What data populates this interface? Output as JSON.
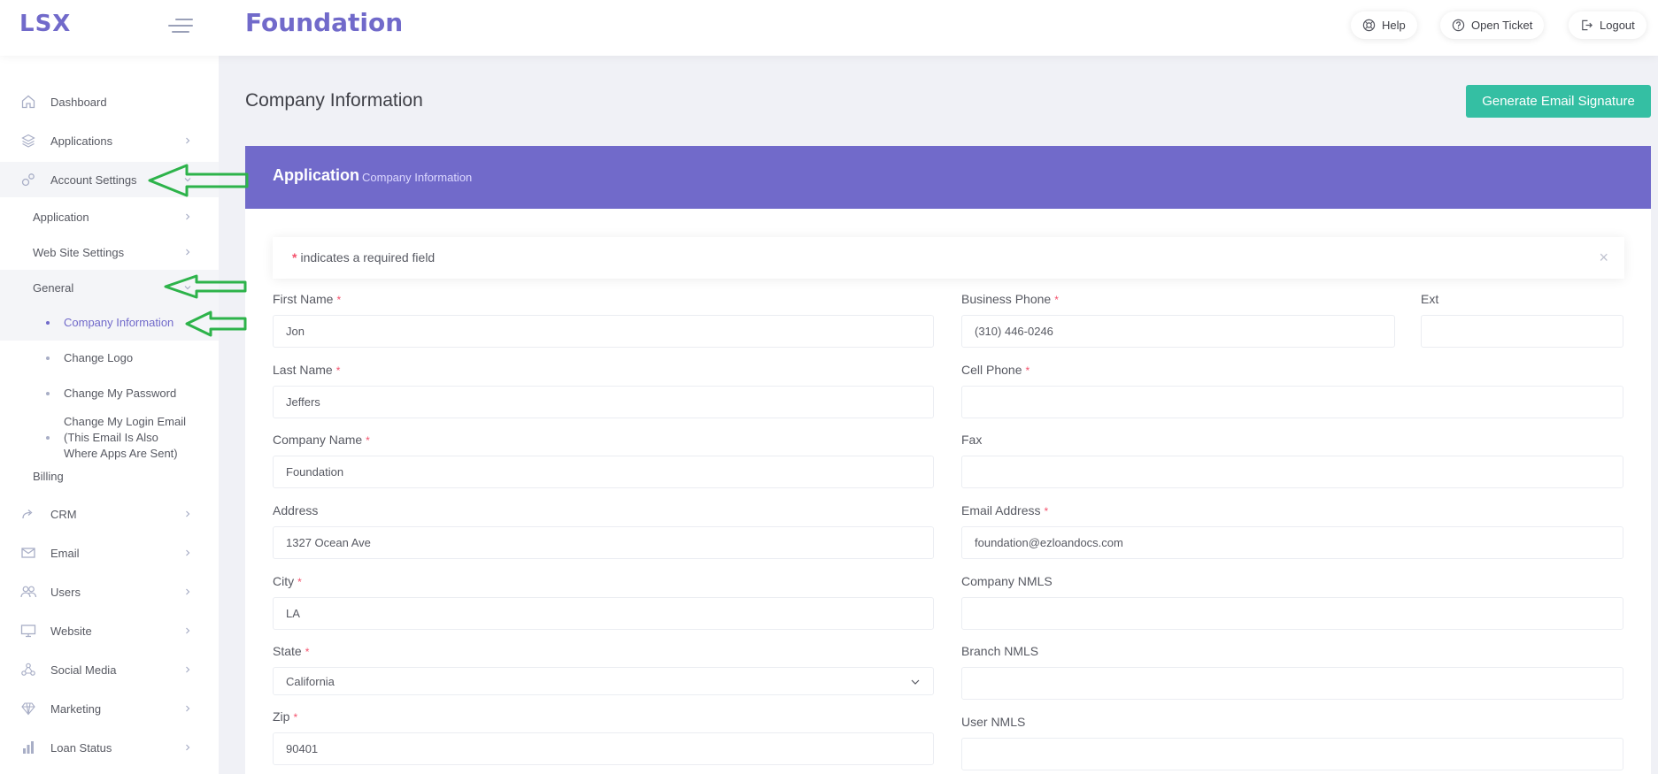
{
  "header": {
    "logo": "LSX",
    "title": "Foundation",
    "buttons": {
      "help": "Help",
      "open_ticket": "Open Ticket",
      "logout": "Logout"
    }
  },
  "sidebar": {
    "items": {
      "dashboard": "Dashboard",
      "applications": "Applications",
      "account_settings": "Account Settings",
      "application": "Application",
      "web_site_settings": "Web Site Settings",
      "general": "General",
      "company_information": "Company Information",
      "change_logo": "Change Logo",
      "change_password": "Change My Password",
      "change_login_email_1": "Change My Login Email",
      "change_login_email_2": "(This Email Is Also",
      "change_login_email_3": "Where Apps Are Sent)",
      "billing": "Billing",
      "crm": "CRM",
      "email": "Email",
      "users": "Users",
      "website": "Website",
      "social_media": "Social Media",
      "marketing": "Marketing",
      "loan_status": "Loan Status"
    }
  },
  "main": {
    "heading": "Company Information",
    "generate_button": "Generate Email Signature",
    "portlet": {
      "title": "Application",
      "subtitle": "Company Information"
    },
    "alert": {
      "asterisk": "*",
      "text": "indicates a required field",
      "close": "×"
    }
  },
  "form": {
    "required_mark": "*",
    "first_name": {
      "label": "First Name",
      "value": "Jon"
    },
    "last_name": {
      "label": "Last Name",
      "value": "Jeffers"
    },
    "company_name": {
      "label": "Company Name",
      "value": "Foundation"
    },
    "address": {
      "label": "Address",
      "value": "1327 Ocean Ave"
    },
    "city": {
      "label": "City",
      "value": "LA"
    },
    "state": {
      "label": "State",
      "value": "California"
    },
    "zip": {
      "label": "Zip",
      "value": "90401"
    },
    "business_phone": {
      "label": "Business Phone",
      "value": "(310) 446-0246"
    },
    "ext": {
      "label": "Ext",
      "value": ""
    },
    "cell_phone": {
      "label": "Cell Phone",
      "value": ""
    },
    "fax": {
      "label": "Fax",
      "value": ""
    },
    "email_address": {
      "label": "Email Address",
      "value": "foundation@ezloandocs.com"
    },
    "company_nmls": {
      "label": "Company NMLS",
      "value": ""
    },
    "branch_nmls": {
      "label": "Branch NMLS",
      "value": ""
    },
    "user_nmls": {
      "label": "User NMLS",
      "value": ""
    }
  },
  "colors": {
    "accent": "#716aca",
    "success": "#34bfa3",
    "required": "#f4516c",
    "annotation_arrow": "#2db34a"
  }
}
